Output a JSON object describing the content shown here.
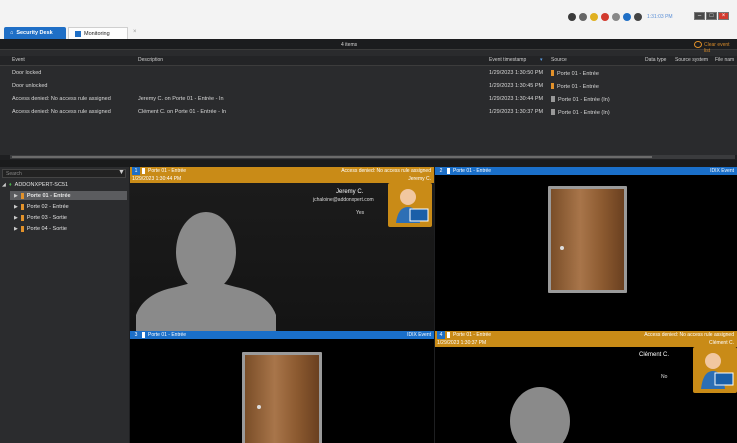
{
  "tabs": [
    {
      "label": "Security Desk",
      "icon": "home-icon"
    },
    {
      "label": "Monitoring",
      "icon": "monitoring-icon"
    }
  ],
  "tray": {
    "clock": "1:31:03 PM"
  },
  "events": {
    "count_label": "4 items",
    "clear_label": "Clear event list",
    "columns": [
      "Event",
      "Description",
      "Event timestamp",
      "Source",
      "Data type",
      "Source system",
      "File nam"
    ],
    "rows": [
      {
        "event": "Door locked",
        "description": "",
        "timestamp": "1/29/2023 1:30:50 PM",
        "source": "Porte 01 - Entrée"
      },
      {
        "event": "Door unlocked",
        "description": "",
        "timestamp": "1/29/2023 1:30:45 PM",
        "source": "Porte 01 - Entrée"
      },
      {
        "event": "Access denied: No access rule assigned",
        "description": "Jeremy C. on Porte 01 - Entrée - In",
        "timestamp": "1/29/2023 1:30:44 PM",
        "source": "Porte 01 - Entrée (In)"
      },
      {
        "event": "Access denied: No access rule assigned",
        "description": "Clément C. on Porte 01 - Entrée - In",
        "timestamp": "1/29/2023 1:30:37 PM",
        "source": "Porte 01 - Entrée (In)"
      }
    ]
  },
  "tree": {
    "search_placeholder": "Search",
    "root": "ADDONXPERT-SC51",
    "items": [
      "Porte 01 - Entrée",
      "Porte 02 - Entrée",
      "Porte 03 - Sortie",
      "Porte 04 - Sortie"
    ]
  },
  "tiles": [
    {
      "num": "1",
      "title": "Porte 01 - Entrée",
      "event": "Access denied: No access rule assigned",
      "time": "1/29/2023 1:30:44 PM",
      "person": "Jeremy C.",
      "email": "jchaloine@addonxpert.com",
      "answer": "Yes"
    },
    {
      "num": "2",
      "title": "Porte 01 - Entrée",
      "event": "IDIX Event"
    },
    {
      "num": "3",
      "title": "Porte 01 - Entrée",
      "event": "IDIX Event"
    },
    {
      "num": "4",
      "title": "Porte 01 - Entrée",
      "event": "Access denied: No access rule assigned",
      "time": "1/29/2023 1:30:37 PM",
      "person": "Clément C.",
      "answer": "No"
    }
  ],
  "colors": {
    "accent": "#1f6fc6",
    "alarm": "#c98b17",
    "door": "#e3922a"
  }
}
